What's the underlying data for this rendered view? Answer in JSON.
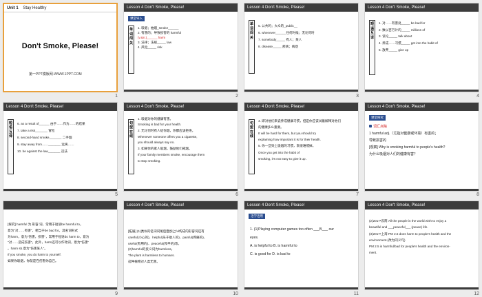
{
  "slides": [
    {
      "num": "1",
      "unit": "Unit 1",
      "unit_sub": "Stay Healthy",
      "title": "Don't Smoke, Please!",
      "subtitle": "第一PPT模板网-WWW.1PPT.COM"
    },
    {
      "num": "2",
      "header": "Lesson 4   Don't Smoke, Please!",
      "tag": "课堂导入",
      "vlabel": "单词闯关",
      "lines": [
        "1. 吸烟；抽烟_smoke______",
        "2. 有害的；导致损害的 harmful",
        "   (v.&n.)______ harm",
        "3. 法律；法规_____ law",
        "4. 风险_____ risk"
      ]
    },
    {
      "num": "3",
      "header": "Lesson 4   Don't Smoke, Please!",
      "vlabel": "单词闯关",
      "lines": [
        "5. 公共的；大众的_public__",
        "6. whenever______任何时候；无论何时",
        "7. somebody_____ 有人；某人",
        "8. disease_____ 疾病；病症"
      ]
    },
    {
      "num": "4",
      "header": "Lesson 4   Don't Smoke, Please!",
      "vlabel": "短语互译",
      "lines": [
        "1. 对……有害处_____ be bad for",
        "2. 数以百万计的_____ millions of",
        "3. 谈论_____ talk about",
        "4. 养成……习惯_____ get into the habit of",
        "5. 放弃_____ give up"
      ]
    },
    {
      "num": "5",
      "header": "Lesson 4   Don't Smoke, Please!",
      "vlabel": "短语互译",
      "lines": [
        "6. as a result of______ 由于……作为……的结果",
        "7. take a risk_______ 冒险",
        "8. second-hand smoke_______ 二手烟",
        "9. stay away from……_______ 远离……",
        "10. be against the law_______ 违法"
      ]
    },
    {
      "num": "6",
      "header": "Lesson 4   Don't Smoke, Please!",
      "vlabel": "句型在线",
      "lines": [
        "1. 吸烟对你的健康有害。",
        "Smoking  is  bad  for  your health.",
        "2. 无论何时有人给你烟，你都应该拒绝。",
        "Whenever  someone  offers  you  a  cigarette,",
        "you should always say no.",
        "3. 如果你的家人吸烟，鼓励他们戒烟。",
        "If your family members smoke, encourage them",
        "to  stop  smoking."
      ]
    },
    {
      "num": "7",
      "header": "Lesson 4   Don't Smoke, Please!",
      "vlabel": "句型在线",
      "lines": [
        "4. 即对他们来说养成健康习惯，但是你应该试着解释对他们",
        "的健康多么重要。",
        "It will be hard for them, but you should  try",
        "explaining how important it is for their health.",
        "5. 你一旦染上吸烟的习惯，就很难戒掉。",
        "Once you  get  into  the  habit  of",
        "smoking, it's not easy to  give  it  up  ."
      ]
    },
    {
      "num": "8",
      "header": "Lesson 4   Don't Smoke, Please!",
      "tag": "课堂探究",
      "lines": [
        "词汇点睛",
        "1  harmful  adj.（尤指对健康或环境）有害的；",
        "导致损害的",
        "[观察] Why is smoking harmful to people's health?",
        "为什么吸烟对人们的健康有害？"
      ]
    },
    {
      "num": "9",
      "header": "",
      "lines": [
        "[探究] harmful 为 形容 词，常用于短语be harmful to，",
        "意为\"对……有害\"，相当于be bad for。其名词形式",
        "为harm，意为\"伤害，损害\"，常用于短语do harm to，意为",
        "\"对……造成伤害\"。此外，harm还可以作动词，意为\"伤害\"",
        "。harm sb.意为\"伤害某人\"。",
        "If you smoke, you do harm to yourself.",
        "如果你吸烟，你就是在伤害你自己。"
      ]
    },
    {
      "num": "10",
      "header": "Lesson 4   Don't Smoke, Please!",
      "lines": [
        "[拓展] (1)类似的名词词尾后面加上ful构成的形容词还有",
        "careful(小心的)、helpful(乐于助人的)、painful(疼痛的)、",
        "useful(有用的)、peaceful(和平的)等。",
        "(2)harmful的反义词为harmless。",
        "The plant is harmless to humans.",
        "这种植物对人类无害。"
      ]
    },
    {
      "num": "11",
      "header": "Lesson 4   Don't Smoke, Please!",
      "tag": "活学活用",
      "lines": [
        "1. (1)Playing computer games too often ___B___ our",
        "eyes.",
        "A. is helpful to    B. is harmful to",
        "C. is good for     D. is bad to"
      ]
    },
    {
      "num": "12",
      "header": "Lesson 4   Don't Smoke, Please!",
      "lines": [
        "(2)2017•云南 All the people in the world wish to enjoy a",
        "beautiful and ___peaceful___ (peace) life.",
        "(3)2017•上海 PM 2.5 does harm to people's health and the",
        "environment.(改为同义句)",
        "PM 2.5 is harmful/bad for people's health and the environ-",
        "ment."
      ]
    }
  ]
}
